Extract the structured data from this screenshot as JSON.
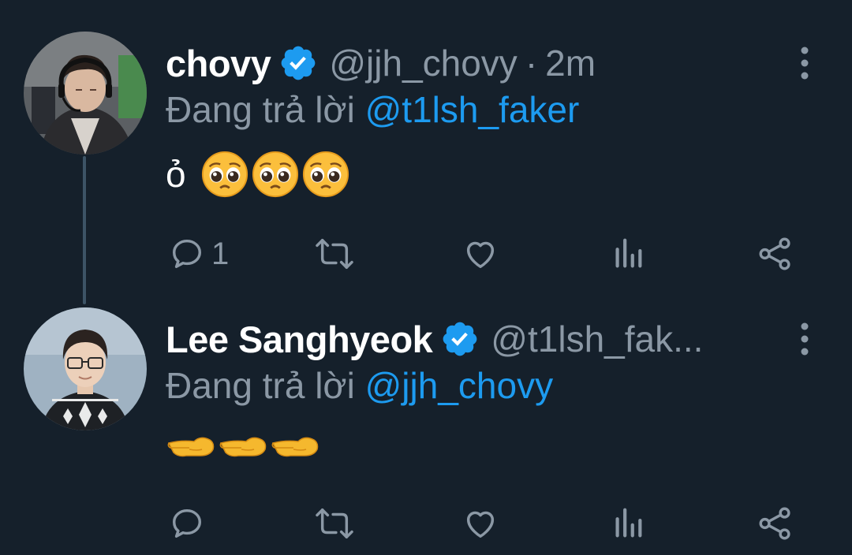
{
  "colors": {
    "background": "#15202b",
    "text_primary": "#ffffff",
    "text_secondary": "#8b98a5",
    "accent": "#1d9bf0",
    "thread_line": "#3d5466"
  },
  "tweets": [
    {
      "display_name": "chovy",
      "verified": true,
      "handle": "@jjh_chovy",
      "separator": "·",
      "time": "2m",
      "reply_prefix": "Đang trả lời",
      "reply_to": "@t1lsh_faker",
      "text": "ỏ",
      "emojis": [
        "pleading-face-emoji",
        "pleading-face-emoji",
        "pleading-face-emoji"
      ],
      "reply_count": "1",
      "icons": [
        "reply-icon",
        "retweet-icon",
        "like-icon",
        "views-icon",
        "share-icon"
      ]
    },
    {
      "display_name": "Lee Sanghyeok",
      "verified": true,
      "handle": "@t1lsh_fak...",
      "reply_prefix": "Đang trả lời",
      "reply_to": "@jjh_chovy",
      "text": "",
      "emojis": [
        "backhand-index-pointing-left-emoji",
        "backhand-index-pointing-left-emoji",
        "backhand-index-pointing-left-emoji"
      ],
      "reply_count": "",
      "icons": [
        "reply-icon",
        "retweet-icon",
        "like-icon",
        "views-icon",
        "share-icon"
      ]
    }
  ]
}
